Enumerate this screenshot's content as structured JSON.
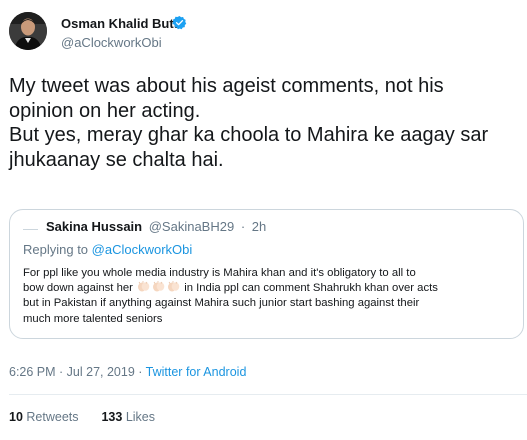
{
  "author": {
    "name": "Osman Khalid Butt",
    "handle": "@aClockworkObi",
    "verified": true
  },
  "tweet_lines": [
    "My tweet was about his ageist comments, not his",
    "opinion on her acting.",
    "But yes, meray ghar ka choola to Mahira ke aagay sar",
    "jhukaanay se chalta hai."
  ],
  "quoted": {
    "name": "Sakina Hussain",
    "handle": "@SakinaBH29",
    "separator": "·",
    "time": "2h",
    "replying_prefix": "Replying to",
    "replying_to": "@aClockworkObi",
    "line1": "For ppl like you whole media industry is Mahira khan and it's obligatory to all to",
    "line2_before": "bow down against her",
    "line2_after": "in India ppl can comment Shahrukh khan over acts",
    "line3": "but in Pakistan if anything against Mahira such junior start bashing against their",
    "line4": "much more talented seniors",
    "emoji": "clapping-hands-icon"
  },
  "meta": {
    "timestamp": "6:26 PM · Jul 27, 2019 ·",
    "source": "Twitter for Android"
  },
  "stats": {
    "retweets_count": "10",
    "retweets_label": "Retweets",
    "likes_count": "133",
    "likes_label": "Likes"
  },
  "colors": {
    "link": "#1b95e0",
    "secondary_text": "#657786",
    "border": "#ccd6dd",
    "verified": "#1da1f2"
  }
}
